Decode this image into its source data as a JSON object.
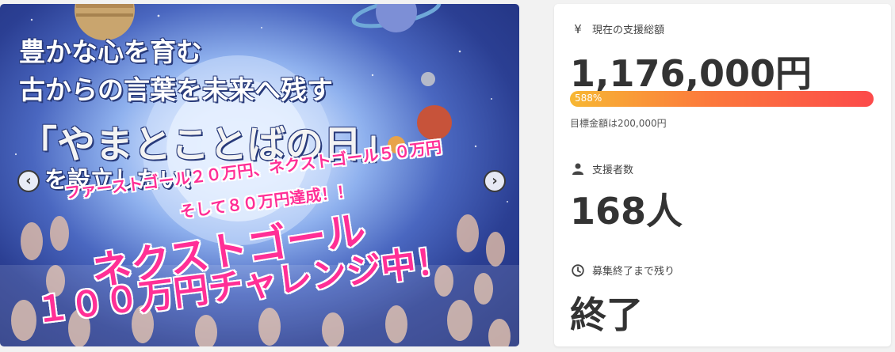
{
  "hero": {
    "title_line1": "豊かな心を育む",
    "title_line2": "古からの言葉を未来へ残す",
    "title_line3": "「やまとことばの日」",
    "title_line4": "を設立したい！",
    "pink_line1": "ファーストゴール２０万円、ネクストゴール５０万円",
    "pink_line2": "そして８０万円達成！！",
    "pink_line3": "ネクストゴール",
    "pink_line4": "１００万円チャレンジ中！",
    "prev_arrow": "‹",
    "next_arrow": "›",
    "colors": {
      "pink": "#ff2f96",
      "sky_dark": "#1f2f7a",
      "glow": "#f4f8ff"
    }
  },
  "stats": {
    "total": {
      "icon": "yen-icon",
      "icon_glyph": "¥",
      "label": "現在の支援総額",
      "value": "1,176,000円",
      "progress_text": "588%",
      "progress_percent": 588,
      "goal_text": "目標金額は200,000円"
    },
    "backers": {
      "icon": "person-icon",
      "label": "支援者数",
      "value": "168人"
    },
    "remaining": {
      "icon": "clock-icon",
      "label": "募集終了まで残り",
      "value": "終了"
    },
    "colors": {
      "bar_start": "#f7b733",
      "bar_end": "#fc4a4a",
      "text": "#333333"
    }
  }
}
